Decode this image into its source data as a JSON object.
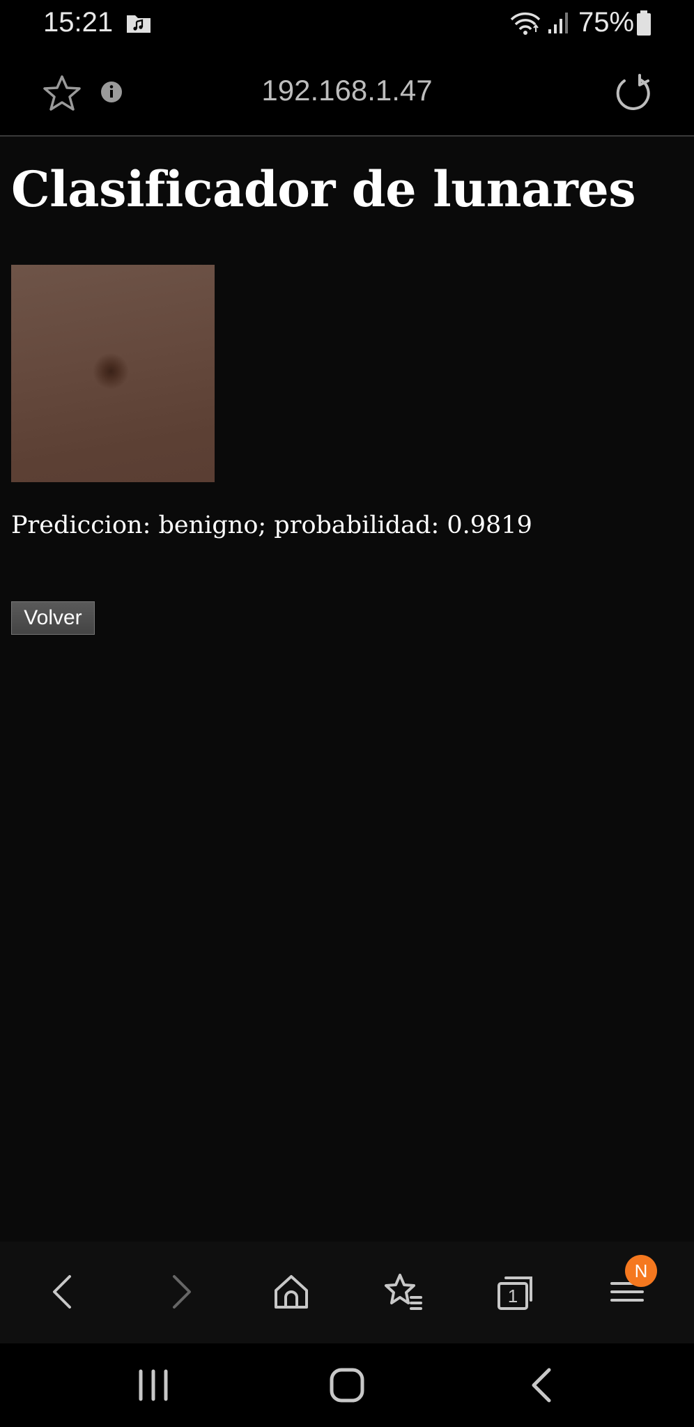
{
  "status_bar": {
    "time": "15:21",
    "battery_percent": "75%",
    "icons": [
      "music-folder-icon",
      "wifi-icon",
      "signal-icon",
      "battery-icon"
    ]
  },
  "address_bar": {
    "url": "192.168.1.47",
    "icons": [
      "star-icon",
      "info-icon",
      "reload-icon"
    ]
  },
  "page": {
    "title": "Clasificador de lunares",
    "prediction": "Prediccion: benigno; probabilidad: 0.9819",
    "back_button_label": "Volver"
  },
  "bottom_toolbar": {
    "icons": [
      "back-icon",
      "forward-icon",
      "home-icon",
      "bookmarks-icon",
      "tabs-icon",
      "menu-icon"
    ],
    "tabs_count": "1",
    "menu_badge": "N",
    "badge_color": "#f5781f"
  },
  "nav_bar": {
    "icons": [
      "recent-apps-icon",
      "home-icon",
      "back-icon"
    ]
  }
}
